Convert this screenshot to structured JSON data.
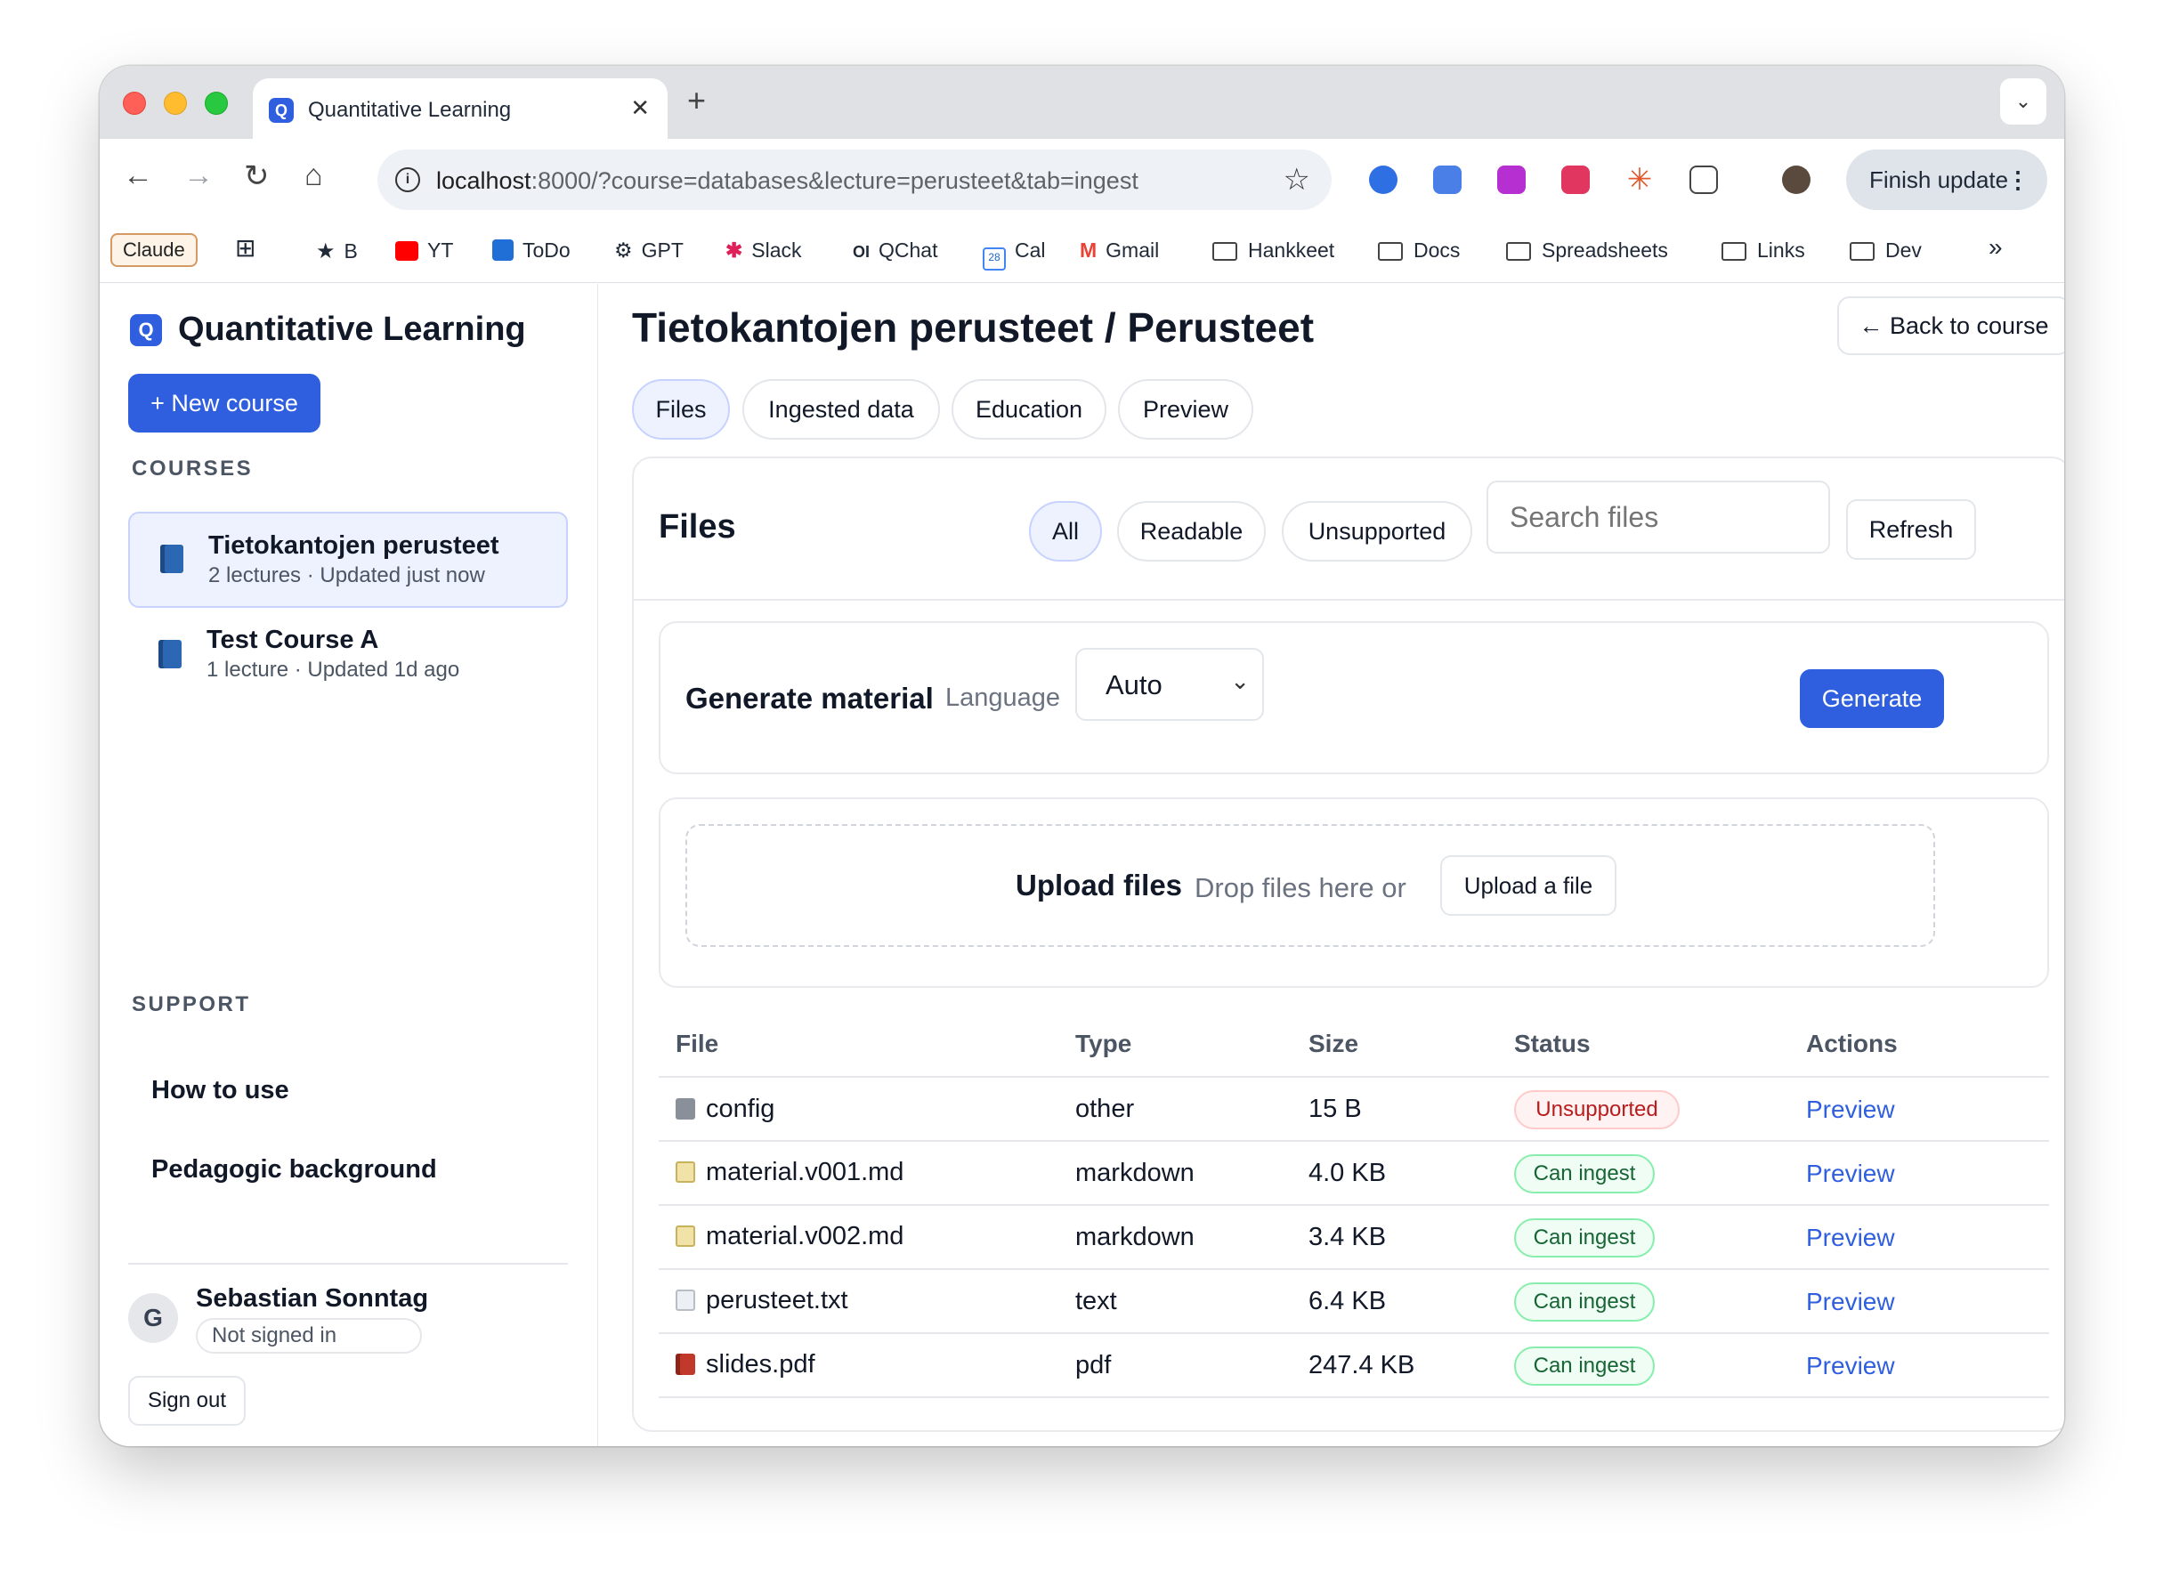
{
  "browser": {
    "tab_title": "Quantitative Learning",
    "tab_favicon": "Q",
    "url_host": "localhost",
    "url_rest": ":8000/?course=databases&lecture=perusteet&tab=ingest",
    "finish_update": "Finish update",
    "bookmarks": [
      "Claude",
      "B",
      "YT",
      "ToDo",
      "GPT",
      "Slack",
      "QChat",
      "Cal",
      "Gmail",
      "Hankkeet",
      "Docs",
      "Spreadsheets",
      "Links",
      "Dev"
    ],
    "cal_day": "28"
  },
  "sidebar": {
    "brand": "Quantitative Learning",
    "new_course": "+ New course",
    "courses_label": "COURSES",
    "courses": [
      {
        "title": "Tietokantojen perusteet",
        "meta": "2 lectures · Updated just now"
      },
      {
        "title": "Test Course A",
        "meta": "1 lecture · Updated 1d ago"
      }
    ],
    "support_label": "SUPPORT",
    "support_links": [
      "How to use",
      "Pedagogic background"
    ],
    "user": {
      "avatar": "G",
      "name": "Sebastian Sonntag",
      "status": "Not signed in",
      "signout": "Sign out"
    }
  },
  "main": {
    "title": "Tietokantojen perusteet / Perusteet",
    "back": "← Back to course",
    "tabs": [
      "Files",
      "Ingested data",
      "Education",
      "Preview"
    ],
    "files": {
      "heading": "Files",
      "filters": [
        "All",
        "Readable",
        "Unsupported"
      ],
      "search_placeholder": "Search files",
      "refresh": "Refresh"
    },
    "generate": {
      "heading": "Generate material",
      "language_label": "Language",
      "language_value": "Auto",
      "button": "Generate"
    },
    "upload": {
      "heading": "Upload files",
      "hint": "Drop files here or",
      "button": "Upload a file"
    },
    "table": {
      "headers": [
        "File",
        "Type",
        "Size",
        "Status",
        "Actions"
      ],
      "rows": [
        {
          "file": "config",
          "type": "other",
          "size": "15 B",
          "status": "Unsupported",
          "action": "Preview"
        },
        {
          "file": "material.v001.md",
          "type": "markdown",
          "size": "4.0 KB",
          "status": "Can ingest",
          "action": "Preview"
        },
        {
          "file": "material.v002.md",
          "type": "markdown",
          "size": "3.4 KB",
          "status": "Can ingest",
          "action": "Preview"
        },
        {
          "file": "perusteet.txt",
          "type": "text",
          "size": "6.4 KB",
          "status": "Can ingest",
          "action": "Preview"
        },
        {
          "file": "slides.pdf",
          "type": "pdf",
          "size": "247.4 KB",
          "status": "Can ingest",
          "action": "Preview"
        }
      ]
    }
  },
  "colors": {
    "accent": "#2f5fde",
    "danger": "#b91c1c",
    "success": "#166534"
  }
}
